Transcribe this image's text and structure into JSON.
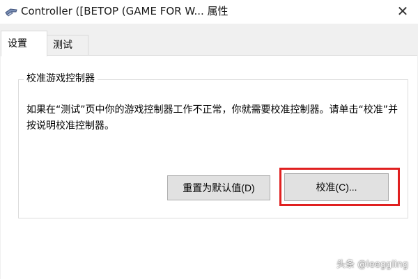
{
  "window": {
    "title": "Controller ([BETOP (GAME FOR W... 属性",
    "close_icon": "close-icon",
    "icon": "gamepad-icon"
  },
  "tabs": [
    {
      "label": "设置",
      "active": true
    },
    {
      "label": "测试",
      "active": false
    }
  ],
  "group": {
    "title": "校准游戏控制器",
    "description": "如果在“测试”页中你的游戏控制器工作不正常，你就需要校准控制器。请单击“校准”并按说明校准控制器。"
  },
  "buttons": {
    "reset_label": "重置为默认值(D)",
    "calibrate_label": "校准(C)..."
  },
  "watermark": "头条 @leeggling",
  "colors": {
    "highlight": "#e02020",
    "window_bg": "#f0f0f0",
    "panel_bg": "#ffffff"
  }
}
